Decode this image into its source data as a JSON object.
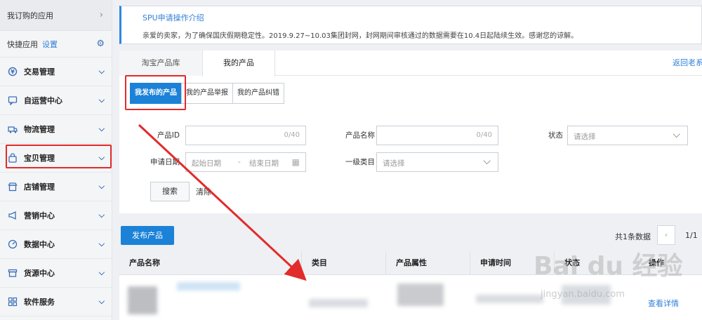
{
  "sidebar": {
    "subscribed": "我订购的应用",
    "quick_label": "快捷应用",
    "quick_setting": "设置",
    "items": [
      {
        "label": "交易管理",
        "icon": "transaction-icon"
      },
      {
        "label": "自运营中心",
        "icon": "chat-icon"
      },
      {
        "label": "物流管理",
        "icon": "truck-icon"
      },
      {
        "label": "宝贝管理",
        "icon": "bag-icon"
      },
      {
        "label": "店铺管理",
        "icon": "store-icon"
      },
      {
        "label": "营销中心",
        "icon": "megaphone-icon"
      },
      {
        "label": "数据中心",
        "icon": "dashboard-icon"
      },
      {
        "label": "货源中心",
        "icon": "box-icon"
      },
      {
        "label": "软件服务",
        "icon": "grid-icon"
      }
    ]
  },
  "notice": {
    "title": "SPU申请操作介绍",
    "text": "亲爱的卖家，为了确保国庆假期稳定性。2019.9.27~10.03集团封网，封网期间审核通过的数据需要在10.4日起陆续生效。感谢您的谅解。"
  },
  "tabs": {
    "taobao_lib": "淘宝产品库",
    "my_products": "我的产品",
    "back": "返回老系"
  },
  "subtabs": {
    "published": "我发布的产品",
    "report": "我的产品举报",
    "correct": "我的产品纠错"
  },
  "filters": {
    "product_id_label": "产品ID",
    "product_id_count": "0/40",
    "product_name_label": "产品名称",
    "product_name_count": "0/40",
    "status_label": "状态",
    "status_placeholder": "请选择",
    "date_label": "申请日期",
    "start_date": "起始日期",
    "date_sep": "-",
    "end_date": "结束日期",
    "category_label": "一级类目",
    "category_placeholder": "请选择",
    "search_button": "搜索",
    "clear_button": "清除"
  },
  "actions": {
    "publish_button": "发布产品",
    "count": "共1条数据",
    "page": "1/1"
  },
  "table": {
    "columns": [
      "产品名称",
      "类目",
      "产品属性",
      "申请时间",
      "状态",
      "操作"
    ],
    "detail_link": "查看详情"
  },
  "watermark": {
    "brand": "Bai du 经验",
    "url": "jingyan.baidu.com"
  },
  "colors": {
    "accent": "#1b82d8",
    "highlight": "#e22b2b",
    "link": "#2e7fd8"
  }
}
